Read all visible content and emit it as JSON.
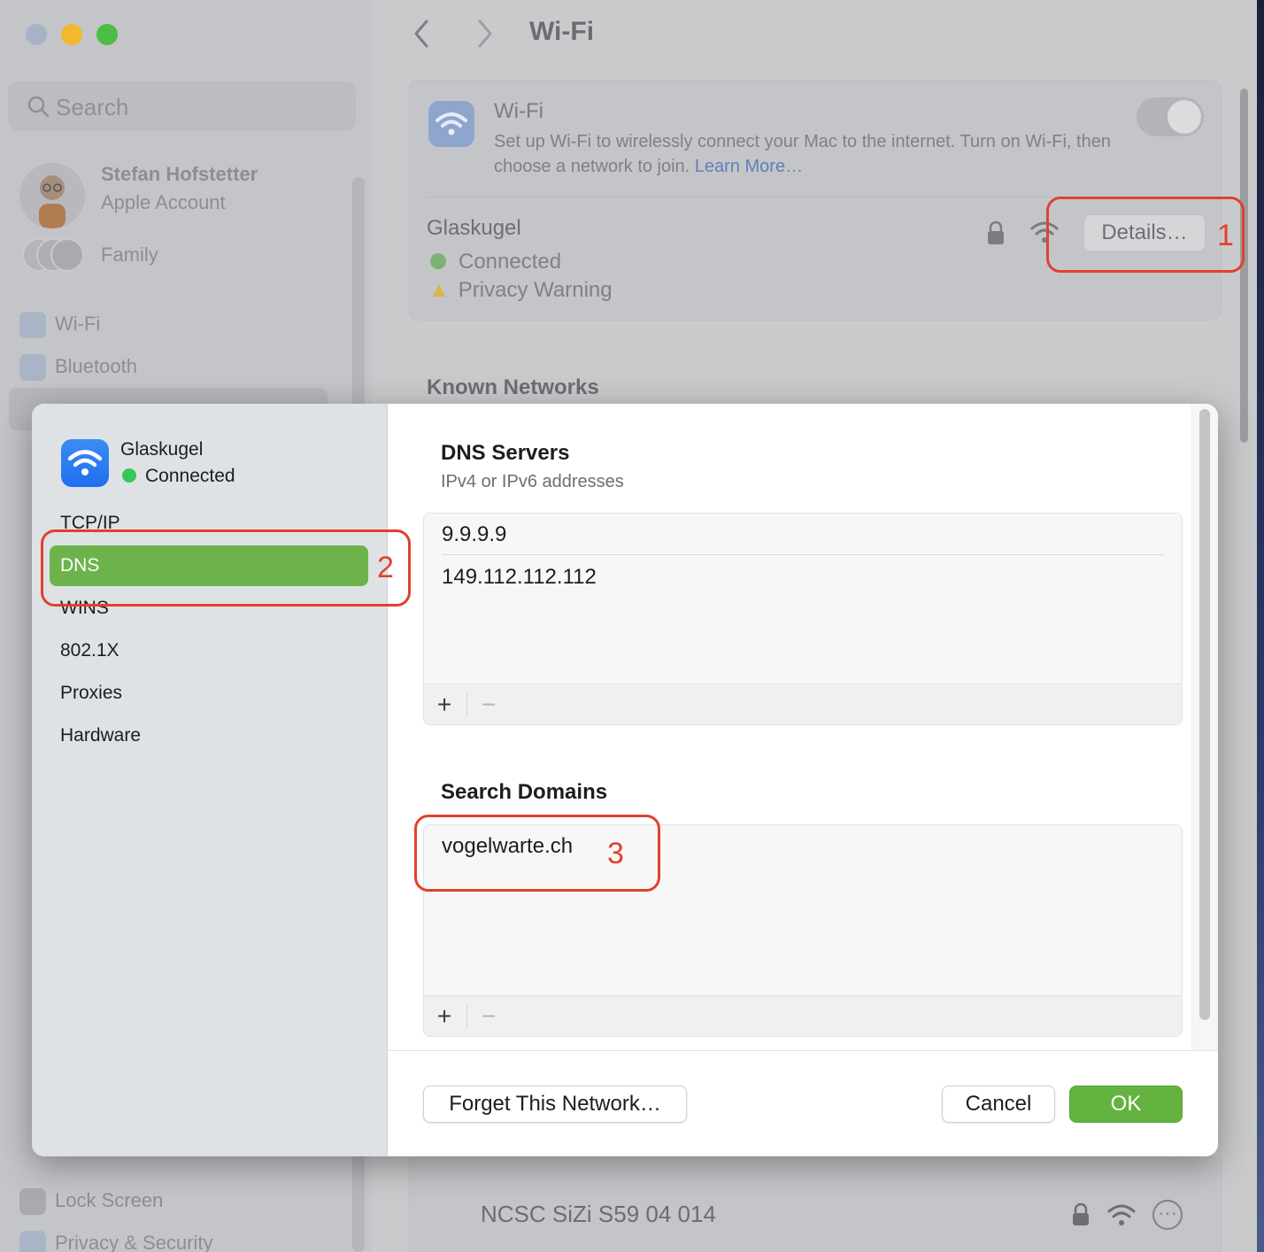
{
  "window": {
    "title": "Wi-Fi"
  },
  "sidebar": {
    "search_placeholder": "Search",
    "account_name": "Stefan Hofstetter",
    "account_sub": "Apple Account",
    "family_label": "Family",
    "items": [
      {
        "label": "Wi-Fi",
        "icon": "wifi-icon"
      },
      {
        "label": "Bluetooth",
        "icon": "bluetooth-icon"
      }
    ],
    "bottom_items": [
      {
        "label": "Lock Screen",
        "icon": "lock-screen-icon"
      },
      {
        "label": "Privacy & Security",
        "icon": "hand-icon"
      }
    ]
  },
  "wifi_panel": {
    "title": "Wi-Fi",
    "description": "Set up Wi-Fi to wirelessly connect your Mac to the internet. Turn on Wi-Fi, then choose a network to join.",
    "learn_more": "Learn More…",
    "toggle_on": true,
    "current_network": {
      "name": "Glaskugel",
      "status": "Connected",
      "warning": "Privacy Warning",
      "details_label": "Details…"
    },
    "known_networks_title": "Known Networks",
    "known_networks": [
      {
        "name": "NCSC SiZi S59 04 014"
      }
    ]
  },
  "sheet": {
    "network_name": "Glaskugel",
    "network_status": "Connected",
    "nav": [
      {
        "label": "TCP/IP",
        "active": false
      },
      {
        "label": "DNS",
        "active": true
      },
      {
        "label": "WINS",
        "active": false
      },
      {
        "label": "802.1X",
        "active": false
      },
      {
        "label": "Proxies",
        "active": false
      },
      {
        "label": "Hardware",
        "active": false
      }
    ],
    "dns": {
      "title": "DNS Servers",
      "subtitle": "IPv4 or IPv6 addresses",
      "servers": [
        "9.9.9.9",
        "149.112.112.112"
      ]
    },
    "search_domains": {
      "title": "Search Domains",
      "domains": [
        "vogelwarte.ch"
      ]
    },
    "toolbar": {
      "add": "+",
      "remove": "−"
    },
    "buttons": {
      "forget": "Forget This Network…",
      "cancel": "Cancel",
      "ok": "OK"
    }
  },
  "annotations": [
    "1",
    "2",
    "3"
  ],
  "colors": {
    "accent_green": "#64b340",
    "annotation_red": "#e0412f",
    "wifi_blue": "#1f6ef0",
    "connected_green": "#34c759"
  }
}
